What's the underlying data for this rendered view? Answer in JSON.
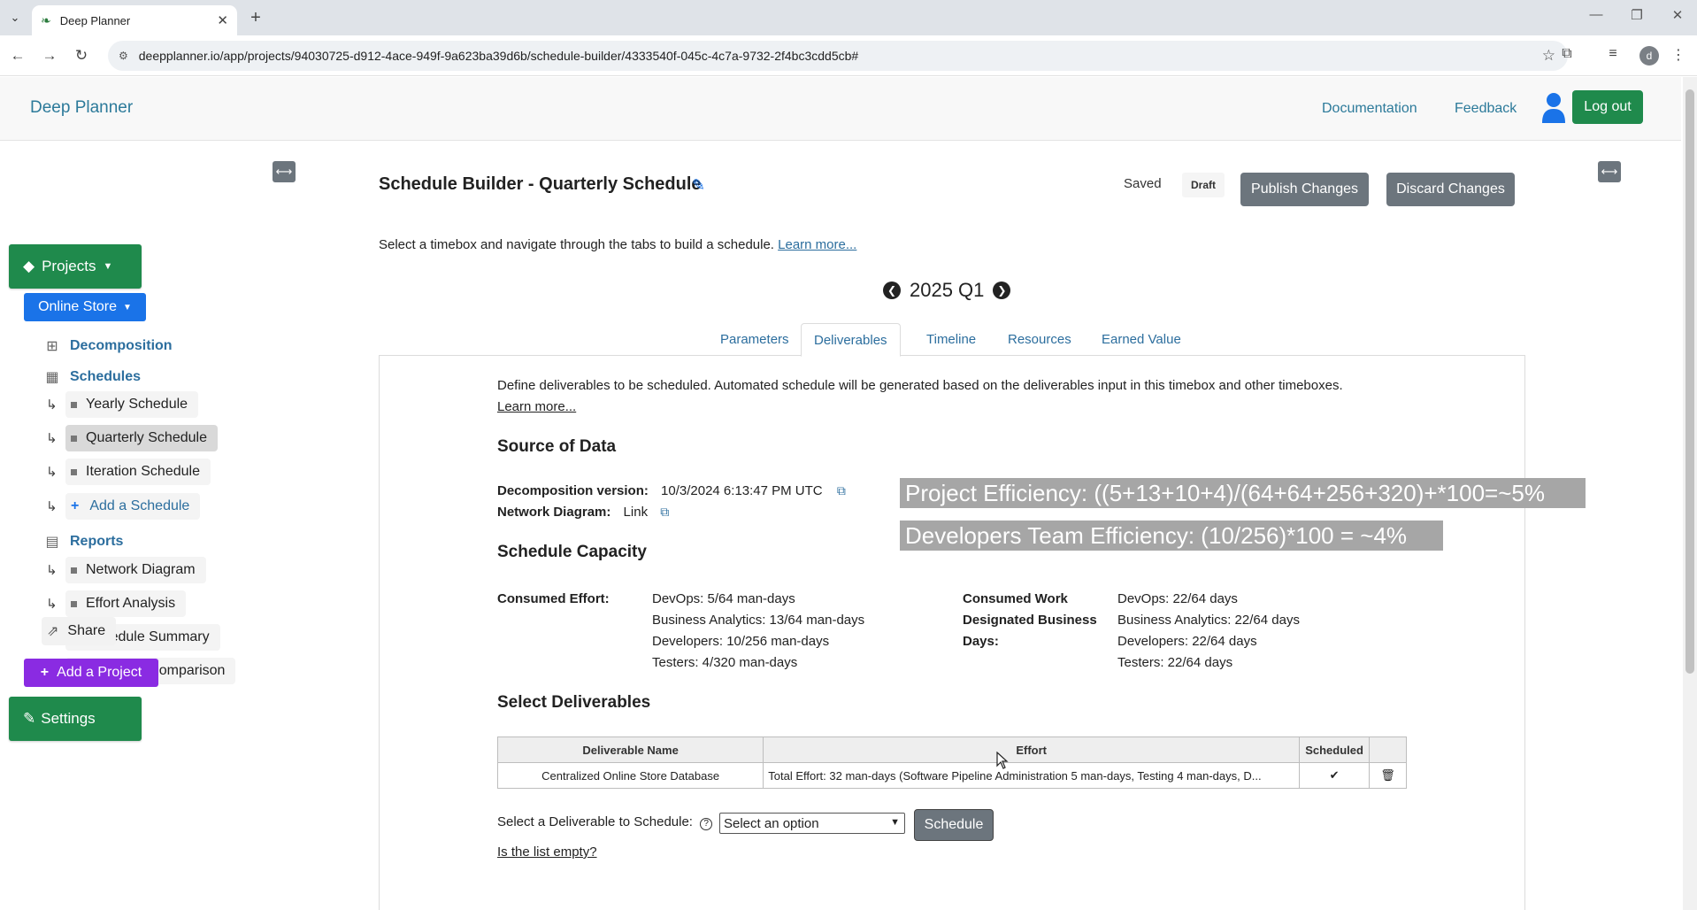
{
  "browser": {
    "tab_title": "Deep Planner",
    "url": "deepplanner.io/app/projects/94030725-d912-4ace-949f-9a623ba39d6b/schedule-builder/4333540f-045c-4c7a-9732-2f4bc3cdd5cb#",
    "profile_initial": "d"
  },
  "header": {
    "brand": "Deep Planner",
    "documentation": "Documentation",
    "feedback": "Feedback",
    "logout": "Log out"
  },
  "sidebar": {
    "projects_label": "Projects",
    "project_selector": "Online Store",
    "decomposition": "Decomposition",
    "schedules": "Schedules",
    "schedule_items": [
      "Yearly Schedule",
      "Quarterly Schedule",
      "Iteration Schedule"
    ],
    "add_schedule": "Add a Schedule",
    "reports": "Reports",
    "report_items": [
      "Network Diagram",
      "Effort Analysis",
      "Schedule Summary",
      "Schedule Comparison"
    ],
    "share": "Share",
    "add_project": "Add a Project",
    "settings": "Settings"
  },
  "main": {
    "title": "Schedule Builder - Quarterly Schedule",
    "saved": "Saved",
    "draft": "Draft",
    "publish": "Publish Changes",
    "discard": "Discard Changes",
    "intro": "Select a timebox and navigate through the tabs to build a schedule.",
    "learn_more": "Learn more...",
    "period": "2025 Q1",
    "tabs": [
      "Parameters",
      "Deliverables",
      "Timeline",
      "Resources",
      "Earned Value"
    ],
    "active_tab": "Deliverables"
  },
  "deliverables": {
    "intro": "Define deliverables to be scheduled. Automated schedule will be generated based on the deliverables input in this timebox and other timeboxes.",
    "learn_more": "Learn more...",
    "source_heading": "Source of Data",
    "decomposition_label": "Decomposition version:",
    "decomposition_value": "10/3/2024 6:13:47 PM UTC",
    "network_label": "Network Diagram:",
    "network_value": "Link",
    "capacity_heading": "Schedule Capacity",
    "consumed_effort_label": "Consumed Effort:",
    "consumed_effort": [
      "DevOps: 5/64 man-days",
      "Business Analytics: 13/64 man-days",
      "Developers: 10/256 man-days",
      "Testers: 4/320 man-days"
    ],
    "consumed_work_label_1": "Consumed Work",
    "consumed_work_label_2": "Designated Business",
    "consumed_work_label_3": "Days:",
    "consumed_work": [
      "DevOps: 22/64 days",
      "Business Analytics: 22/64 days",
      "Developers: 22/64 days",
      "Testers: 22/64 days"
    ],
    "select_heading": "Select Deliverables",
    "table_headers": [
      "Deliverable Name",
      "Effort",
      "Scheduled"
    ],
    "rows": [
      {
        "name": "Centralized Online Store Database",
        "effort": "Total Effort: 32 man-days (Software Pipeline Administration 5 man-days, Testing 4 man-days, D..."
      }
    ],
    "select_label": "Select a Deliverable to Schedule:",
    "select_placeholder": "Select an option",
    "schedule_button": "Schedule",
    "empty_link": "Is the list empty?"
  },
  "overlays": {
    "project_efficiency": "Project Efficiency: ((5+13+10+4)/(64+64+256+320)+*100=~5%",
    "developer_efficiency": "Developers Team Efficiency: (10/256)*100 = ~4%"
  },
  "colors": {
    "brand_green": "#1f8a4c",
    "link_blue": "#2c6e9e",
    "primary_blue": "#1a73e8",
    "purple": "#8a2be2",
    "grey_button": "#6c757d",
    "overlay_grey": "#a6a6a6"
  }
}
